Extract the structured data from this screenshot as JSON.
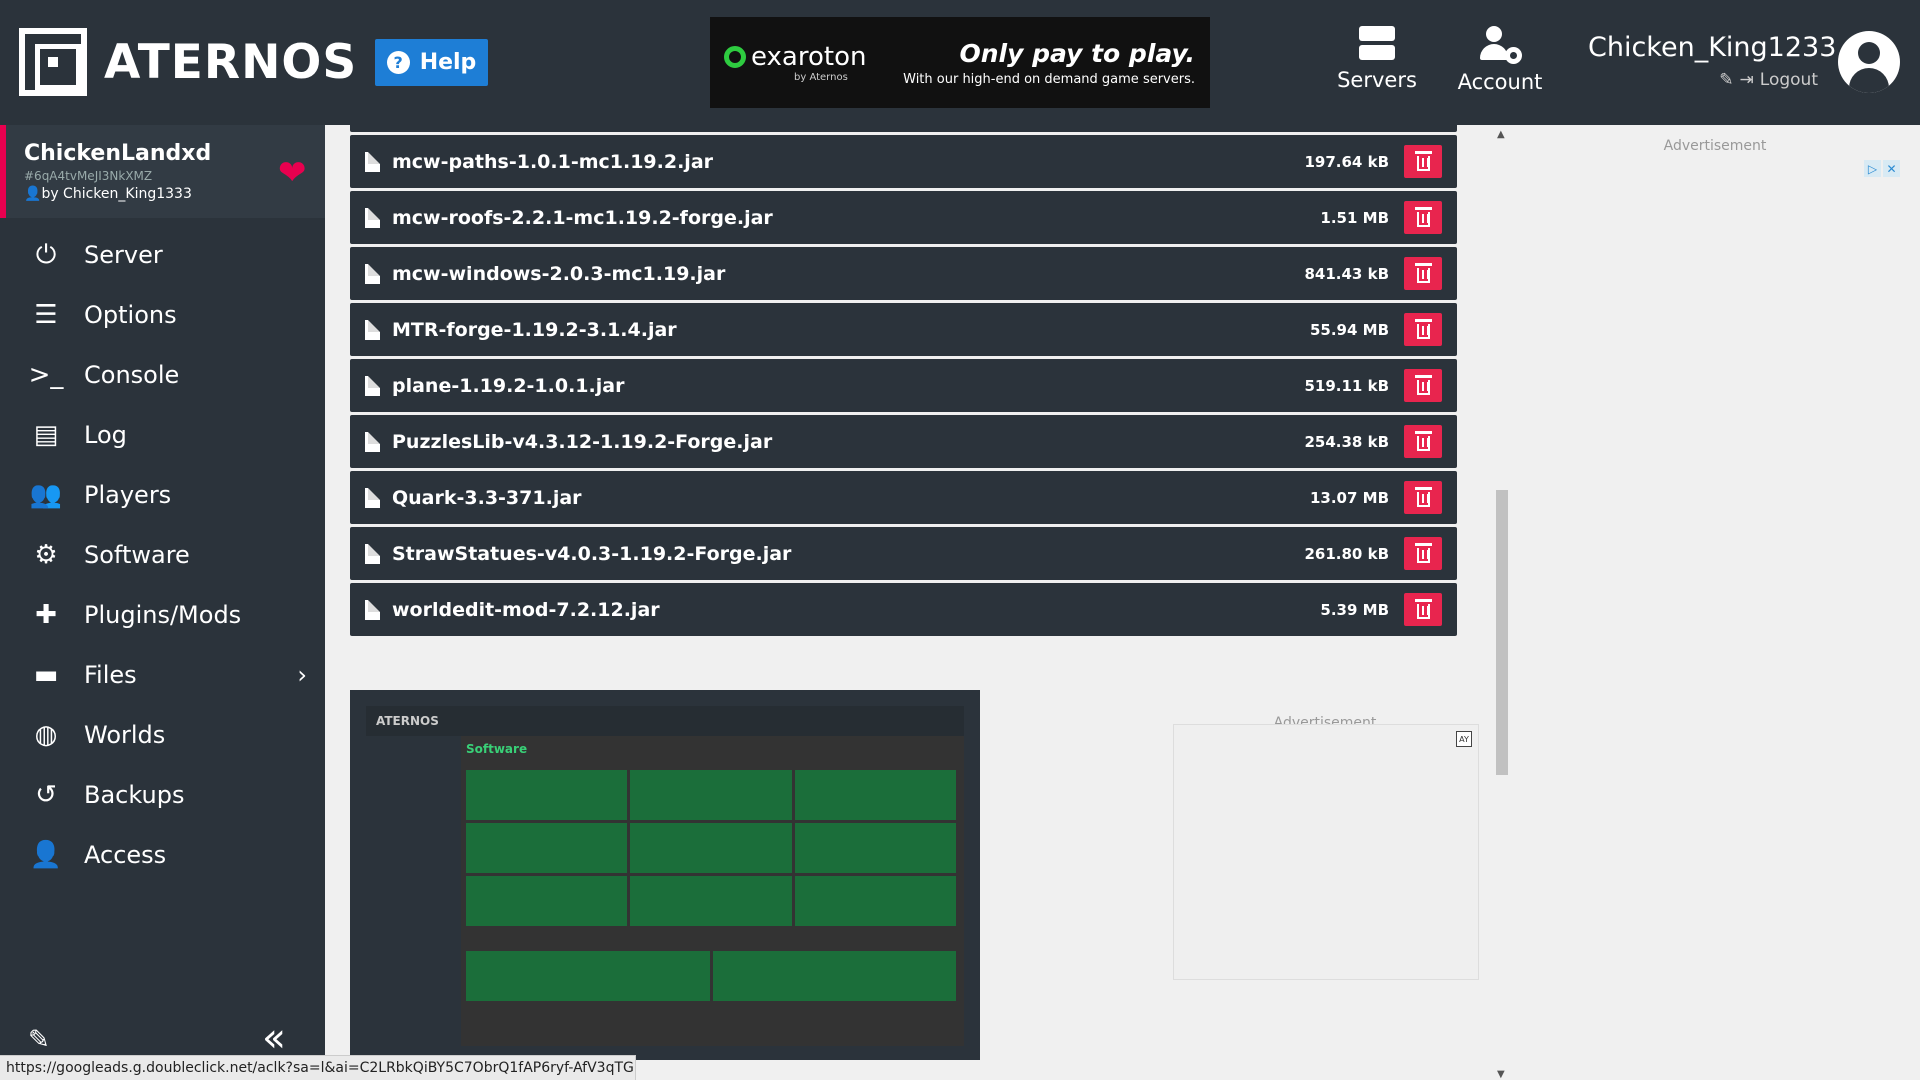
{
  "header": {
    "logo_text": "ATERNOS",
    "help_label": "Help",
    "ad": {
      "brand": "exaroton",
      "brand_sub": "by Aternos",
      "headline": "Only pay to play.",
      "subline": "With our high-end on demand game servers."
    },
    "nav": {
      "servers_label": "Servers",
      "account_label": "Account"
    },
    "user": {
      "name": "Chicken_King1233",
      "logout_label": "Logout"
    }
  },
  "sidebar": {
    "server": {
      "name": "ChickenLandxd",
      "id": "#6qA4tvMeJI3NkXMZ",
      "owner": "by Chicken_King1333"
    },
    "items": [
      {
        "label": "Server",
        "icon": "power-icon"
      },
      {
        "label": "Options",
        "icon": "sliders-icon"
      },
      {
        "label": "Console",
        "icon": "terminal-icon"
      },
      {
        "label": "Log",
        "icon": "document-icon"
      },
      {
        "label": "Players",
        "icon": "users-icon"
      },
      {
        "label": "Software",
        "icon": "gears-icon"
      },
      {
        "label": "Plugins/Mods",
        "icon": "puzzle-icon"
      },
      {
        "label": "Files",
        "icon": "folder-icon"
      },
      {
        "label": "Worlds",
        "icon": "globe-icon"
      },
      {
        "label": "Backups",
        "icon": "history-icon"
      },
      {
        "label": "Access",
        "icon": "user-lock-icon"
      }
    ]
  },
  "files": [
    {
      "name": "mcw-paths-1.0.1-mc1.19.2.jar",
      "size": "197.64 kB"
    },
    {
      "name": "mcw-roofs-2.2.1-mc1.19.2-forge.jar",
      "size": "1.51 MB"
    },
    {
      "name": "mcw-windows-2.0.3-mc1.19.jar",
      "size": "841.43 kB"
    },
    {
      "name": "MTR-forge-1.19.2-3.1.4.jar",
      "size": "55.94 MB"
    },
    {
      "name": "plane-1.19.2-1.0.1.jar",
      "size": "519.11 kB"
    },
    {
      "name": "PuzzlesLib-v4.3.12-1.19.2-Forge.jar",
      "size": "254.38 kB"
    },
    {
      "name": "Quark-3.3-371.jar",
      "size": "13.07 MB"
    },
    {
      "name": "StrawStatues-v4.0.3-1.19.2-Forge.jar",
      "size": "261.80 kB"
    },
    {
      "name": "worldedit-mod-7.2.12.jar",
      "size": "5.39 MB"
    }
  ],
  "preview": {
    "header_text": "ATERNOS",
    "title": "Software"
  },
  "ads": {
    "right_label": "Advertisement",
    "lower_label": "Advertisement"
  },
  "status_url": "https://googleads.g.doubleclick.net/aclk?sa=l&ai=C2LRbkQiBY5C7ObrQ1fAP6ryf-AfV3qTGbe...",
  "colors": {
    "dark_bg": "#2b333b",
    "accent_red": "#e8254e",
    "help_blue": "#1e7ed6",
    "heart": "#e8004f"
  }
}
